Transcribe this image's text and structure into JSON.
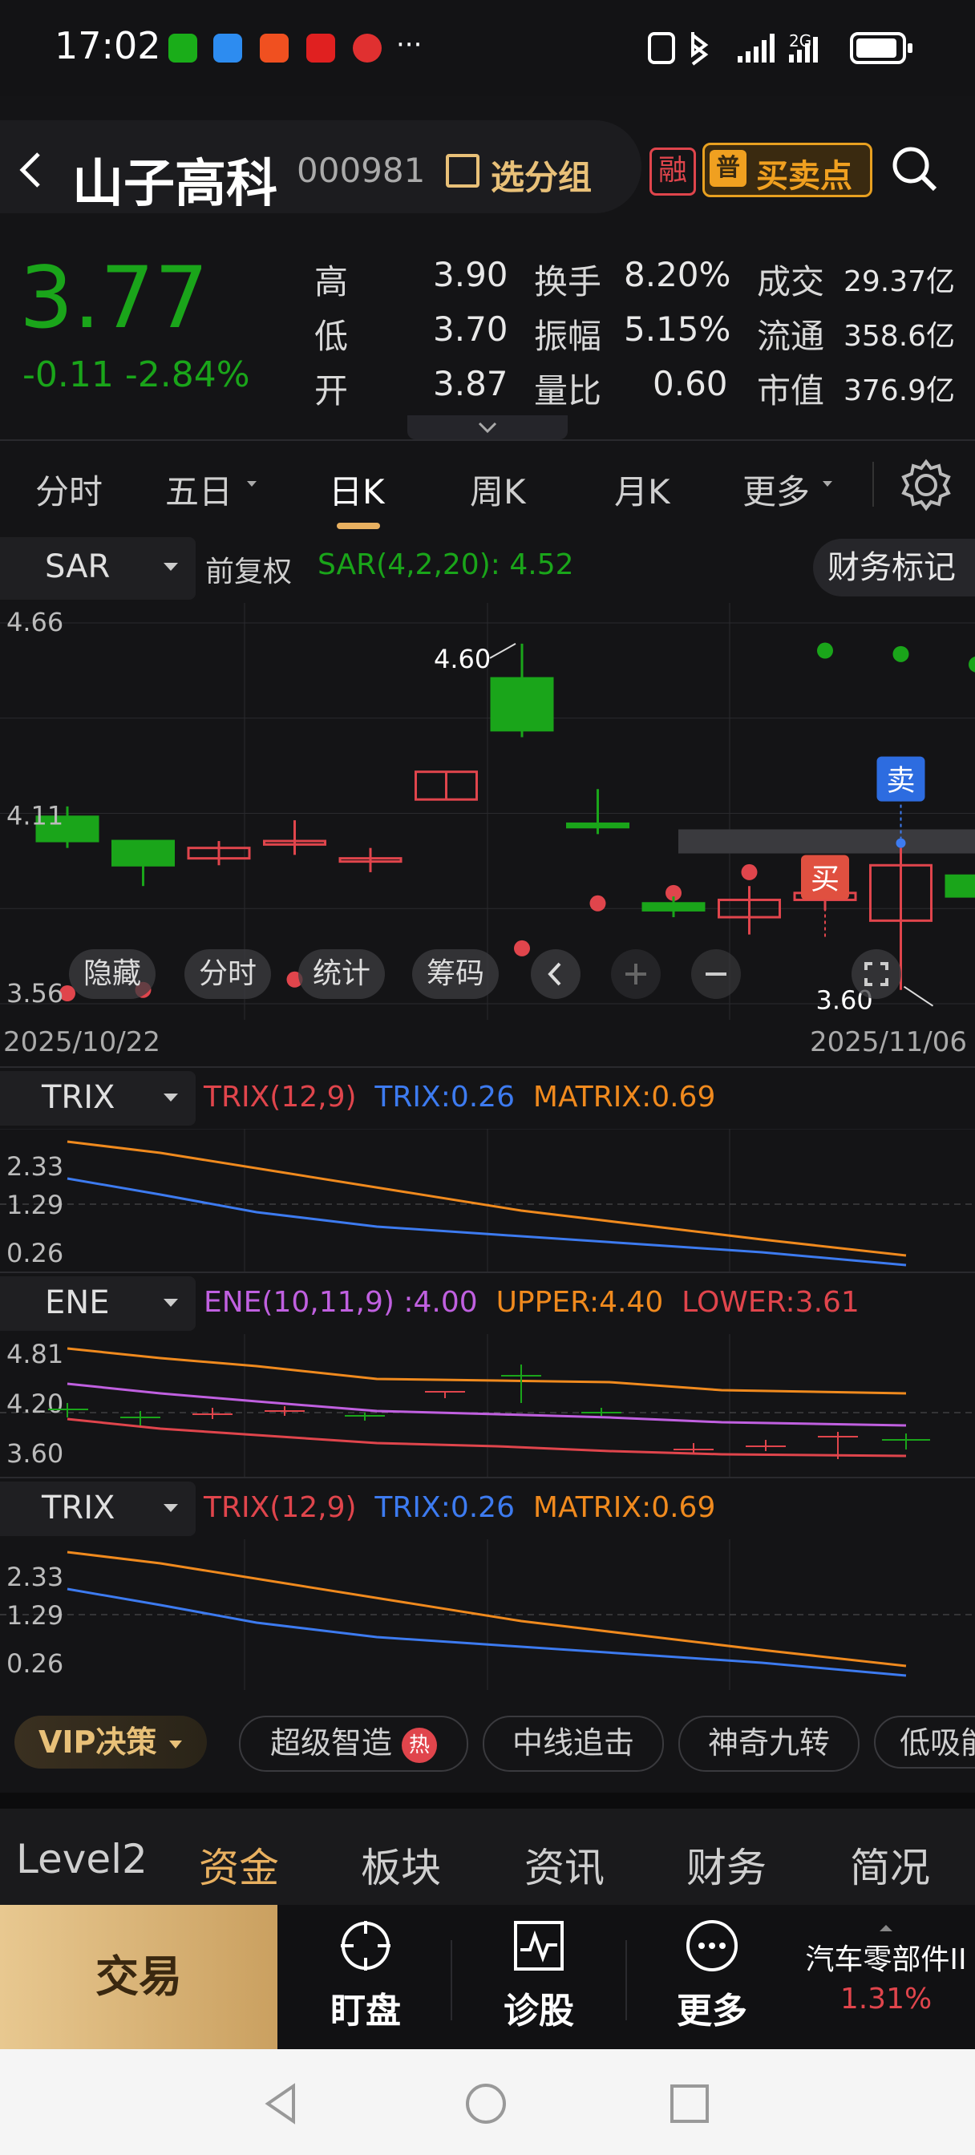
{
  "status_bar": {
    "time": "17:02",
    "more": "···",
    "network": "2G"
  },
  "header": {
    "name": "山子高科",
    "code": "000981",
    "group_label": "选分组",
    "rong_label": "融",
    "buy_sell_label": "买卖点",
    "buy_sell_icon_char": "普"
  },
  "quote": {
    "price": "3.77",
    "change": "-0.11",
    "change_pct": "-2.84%",
    "high_label": "高",
    "high": "3.90",
    "low_label": "低",
    "low": "3.70",
    "open_label": "开",
    "open": "3.87",
    "turnover_label": "换手",
    "turnover": "8.20%",
    "amplitude_label": "振幅",
    "amplitude": "5.15%",
    "volume_ratio_label": "量比",
    "volume_ratio": "0.60",
    "amount_label": "成交",
    "amount": "29.37亿",
    "float_label": "流通",
    "float_cap": "358.6亿",
    "mcap_label": "市值",
    "mcap": "376.9亿"
  },
  "tabs": [
    "分时",
    "五日",
    "日K",
    "周K",
    "月K",
    "更多"
  ],
  "tab_active": "日K",
  "chart_header": {
    "indicator": "SAR",
    "adjust": "前复权",
    "sar_text": "SAR(4,2,20):",
    "sar_value": "4.52",
    "finance_mark": "财务标记"
  },
  "overlay_buttons": [
    "隐藏",
    "分时",
    "统计",
    "筹码"
  ],
  "dates": {
    "start": "2025/10/22",
    "end": "2025/11/06"
  },
  "panels": {
    "trix1": {
      "name": "TRIX",
      "params": "TRIX(12,9)",
      "trix": "TRIX:0.26",
      "matrix": "MATRIX:0.69",
      "y": [
        "2.33",
        "1.29",
        "0.26"
      ]
    },
    "ene": {
      "name": "ENE",
      "params": "ENE(10,11,9)",
      "ene": ":4.00",
      "upper": "UPPER:4.40",
      "lower": "LOWER:3.61",
      "y": [
        "4.81",
        "4.20",
        "3.60"
      ]
    },
    "trix2": {
      "name": "TRIX",
      "params": "TRIX(12,9)",
      "trix": "TRIX:0.26",
      "matrix": "MATRIX:0.69",
      "y": [
        "2.33",
        "1.29",
        "0.26"
      ]
    }
  },
  "vip": {
    "label": "VIP决策",
    "hot": "热",
    "chips": [
      "超级智造",
      "中线追击",
      "神奇九转",
      "低吸能"
    ]
  },
  "bottom_tabs": [
    "Level2",
    "资金",
    "板块",
    "资讯",
    "财务",
    "简况"
  ],
  "bottom_tab_active": "资金",
  "bottom_bar": {
    "trade": "交易",
    "items": [
      {
        "label": "盯盘",
        "icon": "target-icon"
      },
      {
        "label": "诊股",
        "icon": "pulse-chart-icon"
      },
      {
        "label": "更多",
        "icon": "more-circle-icon"
      }
    ],
    "sector_name": "汽车零部件II",
    "sector_change": "1.31%"
  },
  "colors": {
    "up": "#e0454c",
    "down": "#1aa51a",
    "accent": "#f08a1e",
    "blue": "#3d7bf0",
    "purple": "#c060e0"
  },
  "chart_data": {
    "type": "candlestick",
    "indicator": "SAR(4,2,20)",
    "ylim": [
      3.56,
      4.66
    ],
    "y_ticks": [
      "4.66",
      "4.11",
      "3.56"
    ],
    "x_range": [
      "2025/10/22",
      "2025/11/06"
    ],
    "candles": [
      {
        "open": 4.1,
        "close": 4.03,
        "high": 4.13,
        "low": 4.01
      },
      {
        "open": 4.03,
        "close": 3.96,
        "high": 3.99,
        "low": 3.9
      },
      {
        "open": 3.98,
        "close": 4.01,
        "high": 4.03,
        "low": 3.96
      },
      {
        "open": 4.02,
        "close": 4.03,
        "high": 4.09,
        "low": 3.99
      },
      {
        "open": 3.98,
        "close": 3.98,
        "high": 4.01,
        "low": 3.94
      },
      {
        "open": 4.15,
        "close": 4.23,
        "high": 4.23,
        "low": 4.15
      },
      {
        "open": 4.5,
        "close": 4.35,
        "high": 4.6,
        "low": 4.33
      },
      {
        "open": 4.08,
        "close": 4.07,
        "high": 4.18,
        "low": 4.05
      },
      {
        "open": 3.85,
        "close": 3.83,
        "high": 3.87,
        "low": 3.81
      },
      {
        "open": 3.81,
        "close": 3.86,
        "high": 3.9,
        "low": 3.76
      },
      {
        "open": 3.86,
        "close": 3.88,
        "high": 3.9,
        "low": 3.83
      },
      {
        "open": 3.8,
        "close": 3.96,
        "high": 4.01,
        "low": 3.6
      },
      {
        "open": 3.93,
        "close": 3.87,
        "high": 3.94,
        "low": 3.8
      }
    ],
    "sar": [
      3.59,
      3.6,
      null,
      3.63,
      null,
      null,
      3.72,
      3.85,
      3.88,
      3.94,
      4.58,
      4.57,
      4.54
    ],
    "annotations": {
      "high_label": "4.60",
      "low_label": "3.60",
      "buy": "买",
      "sell": "卖"
    }
  }
}
